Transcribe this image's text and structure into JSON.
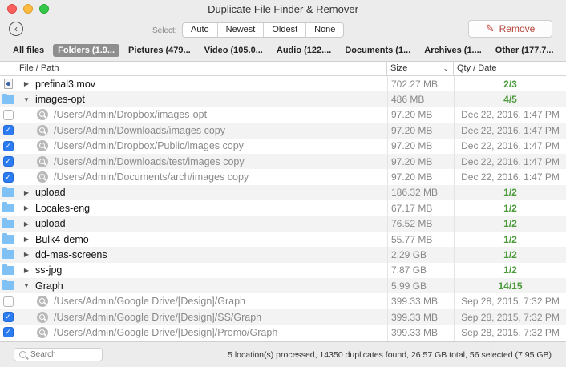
{
  "window": {
    "title": "Duplicate File Finder & Remover"
  },
  "toolbar": {
    "select_label": "Select:",
    "select_options": [
      "Auto",
      "Newest",
      "Oldest",
      "None"
    ],
    "remove_label": "Remove"
  },
  "tabs": [
    {
      "label": "All files",
      "active": false
    },
    {
      "label": "Folders (1.9...",
      "active": true
    },
    {
      "label": "Pictures (479...",
      "active": false
    },
    {
      "label": "Video (105.0...",
      "active": false
    },
    {
      "label": "Audio (122....",
      "active": false
    },
    {
      "label": "Documents (1...",
      "active": false
    },
    {
      "label": "Archives (1....",
      "active": false
    },
    {
      "label": "Other (177.7...",
      "active": false
    }
  ],
  "columns": {
    "path": "File / Path",
    "size": "Size",
    "qty": "Qty / Date"
  },
  "rows": [
    {
      "kind": "group",
      "icon": "file",
      "expanded": false,
      "name": "prefinal3.mov",
      "size": "702.27 MB",
      "qty": "2/3"
    },
    {
      "kind": "group",
      "icon": "folder",
      "expanded": true,
      "name": "images-opt",
      "size": "486 MB",
      "qty": "4/5"
    },
    {
      "kind": "item",
      "checked": false,
      "path": "/Users/Admin/Dropbox/images-opt",
      "size": "97.20 MB",
      "date": "Dec 22, 2016, 1:47 PM"
    },
    {
      "kind": "item",
      "checked": true,
      "path": "/Users/Admin/Downloads/images copy",
      "size": "97.20 MB",
      "date": "Dec 22, 2016, 1:47 PM"
    },
    {
      "kind": "item",
      "checked": true,
      "path": "/Users/Admin/Dropbox/Public/images copy",
      "size": "97.20 MB",
      "date": "Dec 22, 2016, 1:47 PM"
    },
    {
      "kind": "item",
      "checked": true,
      "path": "/Users/Admin/Downloads/test/images copy",
      "size": "97.20 MB",
      "date": "Dec 22, 2016, 1:47 PM"
    },
    {
      "kind": "item",
      "checked": true,
      "path": "/Users/Admin/Documents/arch/images copy",
      "size": "97.20 MB",
      "date": "Dec 22, 2016, 1:47 PM"
    },
    {
      "kind": "group",
      "icon": "folder",
      "expanded": false,
      "name": "upload",
      "size": "186.32 MB",
      "qty": "1/2"
    },
    {
      "kind": "group",
      "icon": "folder",
      "expanded": false,
      "name": "Locales-eng",
      "size": "67.17 MB",
      "qty": "1/2"
    },
    {
      "kind": "group",
      "icon": "folder",
      "expanded": false,
      "name": "upload",
      "size": "76.52 MB",
      "qty": "1/2"
    },
    {
      "kind": "group",
      "icon": "folder",
      "expanded": false,
      "name": "Bulk4-demo",
      "size": "55.77 MB",
      "qty": "1/2"
    },
    {
      "kind": "group",
      "icon": "folder",
      "expanded": false,
      "name": "dd-mas-screens",
      "size": "2.29 GB",
      "qty": "1/2"
    },
    {
      "kind": "group",
      "icon": "folder",
      "expanded": false,
      "name": "ss-jpg",
      "size": "7.87 GB",
      "qty": "1/2"
    },
    {
      "kind": "group",
      "icon": "folder",
      "expanded": true,
      "name": "Graph",
      "size": "5.99 GB",
      "qty": "14/15"
    },
    {
      "kind": "item",
      "checked": false,
      "path": "/Users/Admin/Google Drive/[Design]/Graph",
      "size": "399.33 MB",
      "date": "Sep 28, 2015, 7:32 PM"
    },
    {
      "kind": "item",
      "checked": true,
      "path": "/Users/Admin/Google Drive/[Design]/SS/Graph",
      "size": "399.33 MB",
      "date": "Sep 28, 2015, 7:32 PM"
    },
    {
      "kind": "item",
      "checked": true,
      "path": "/Users/Admin/Google Drive/[Design]/Promo/Graph",
      "size": "399.33 MB",
      "date": "Sep 28, 2015, 7:32 PM"
    }
  ],
  "footer": {
    "search_placeholder": "Search",
    "status": "5 location(s) processed, 14350 duplicates found, 26.57 GB total, 56 selected (7.95 GB)"
  },
  "colors": {
    "accent": "#2b7cf2",
    "qty": "#4a9a3a",
    "remove": "#b5443a",
    "folder": "#7fc1f5"
  }
}
